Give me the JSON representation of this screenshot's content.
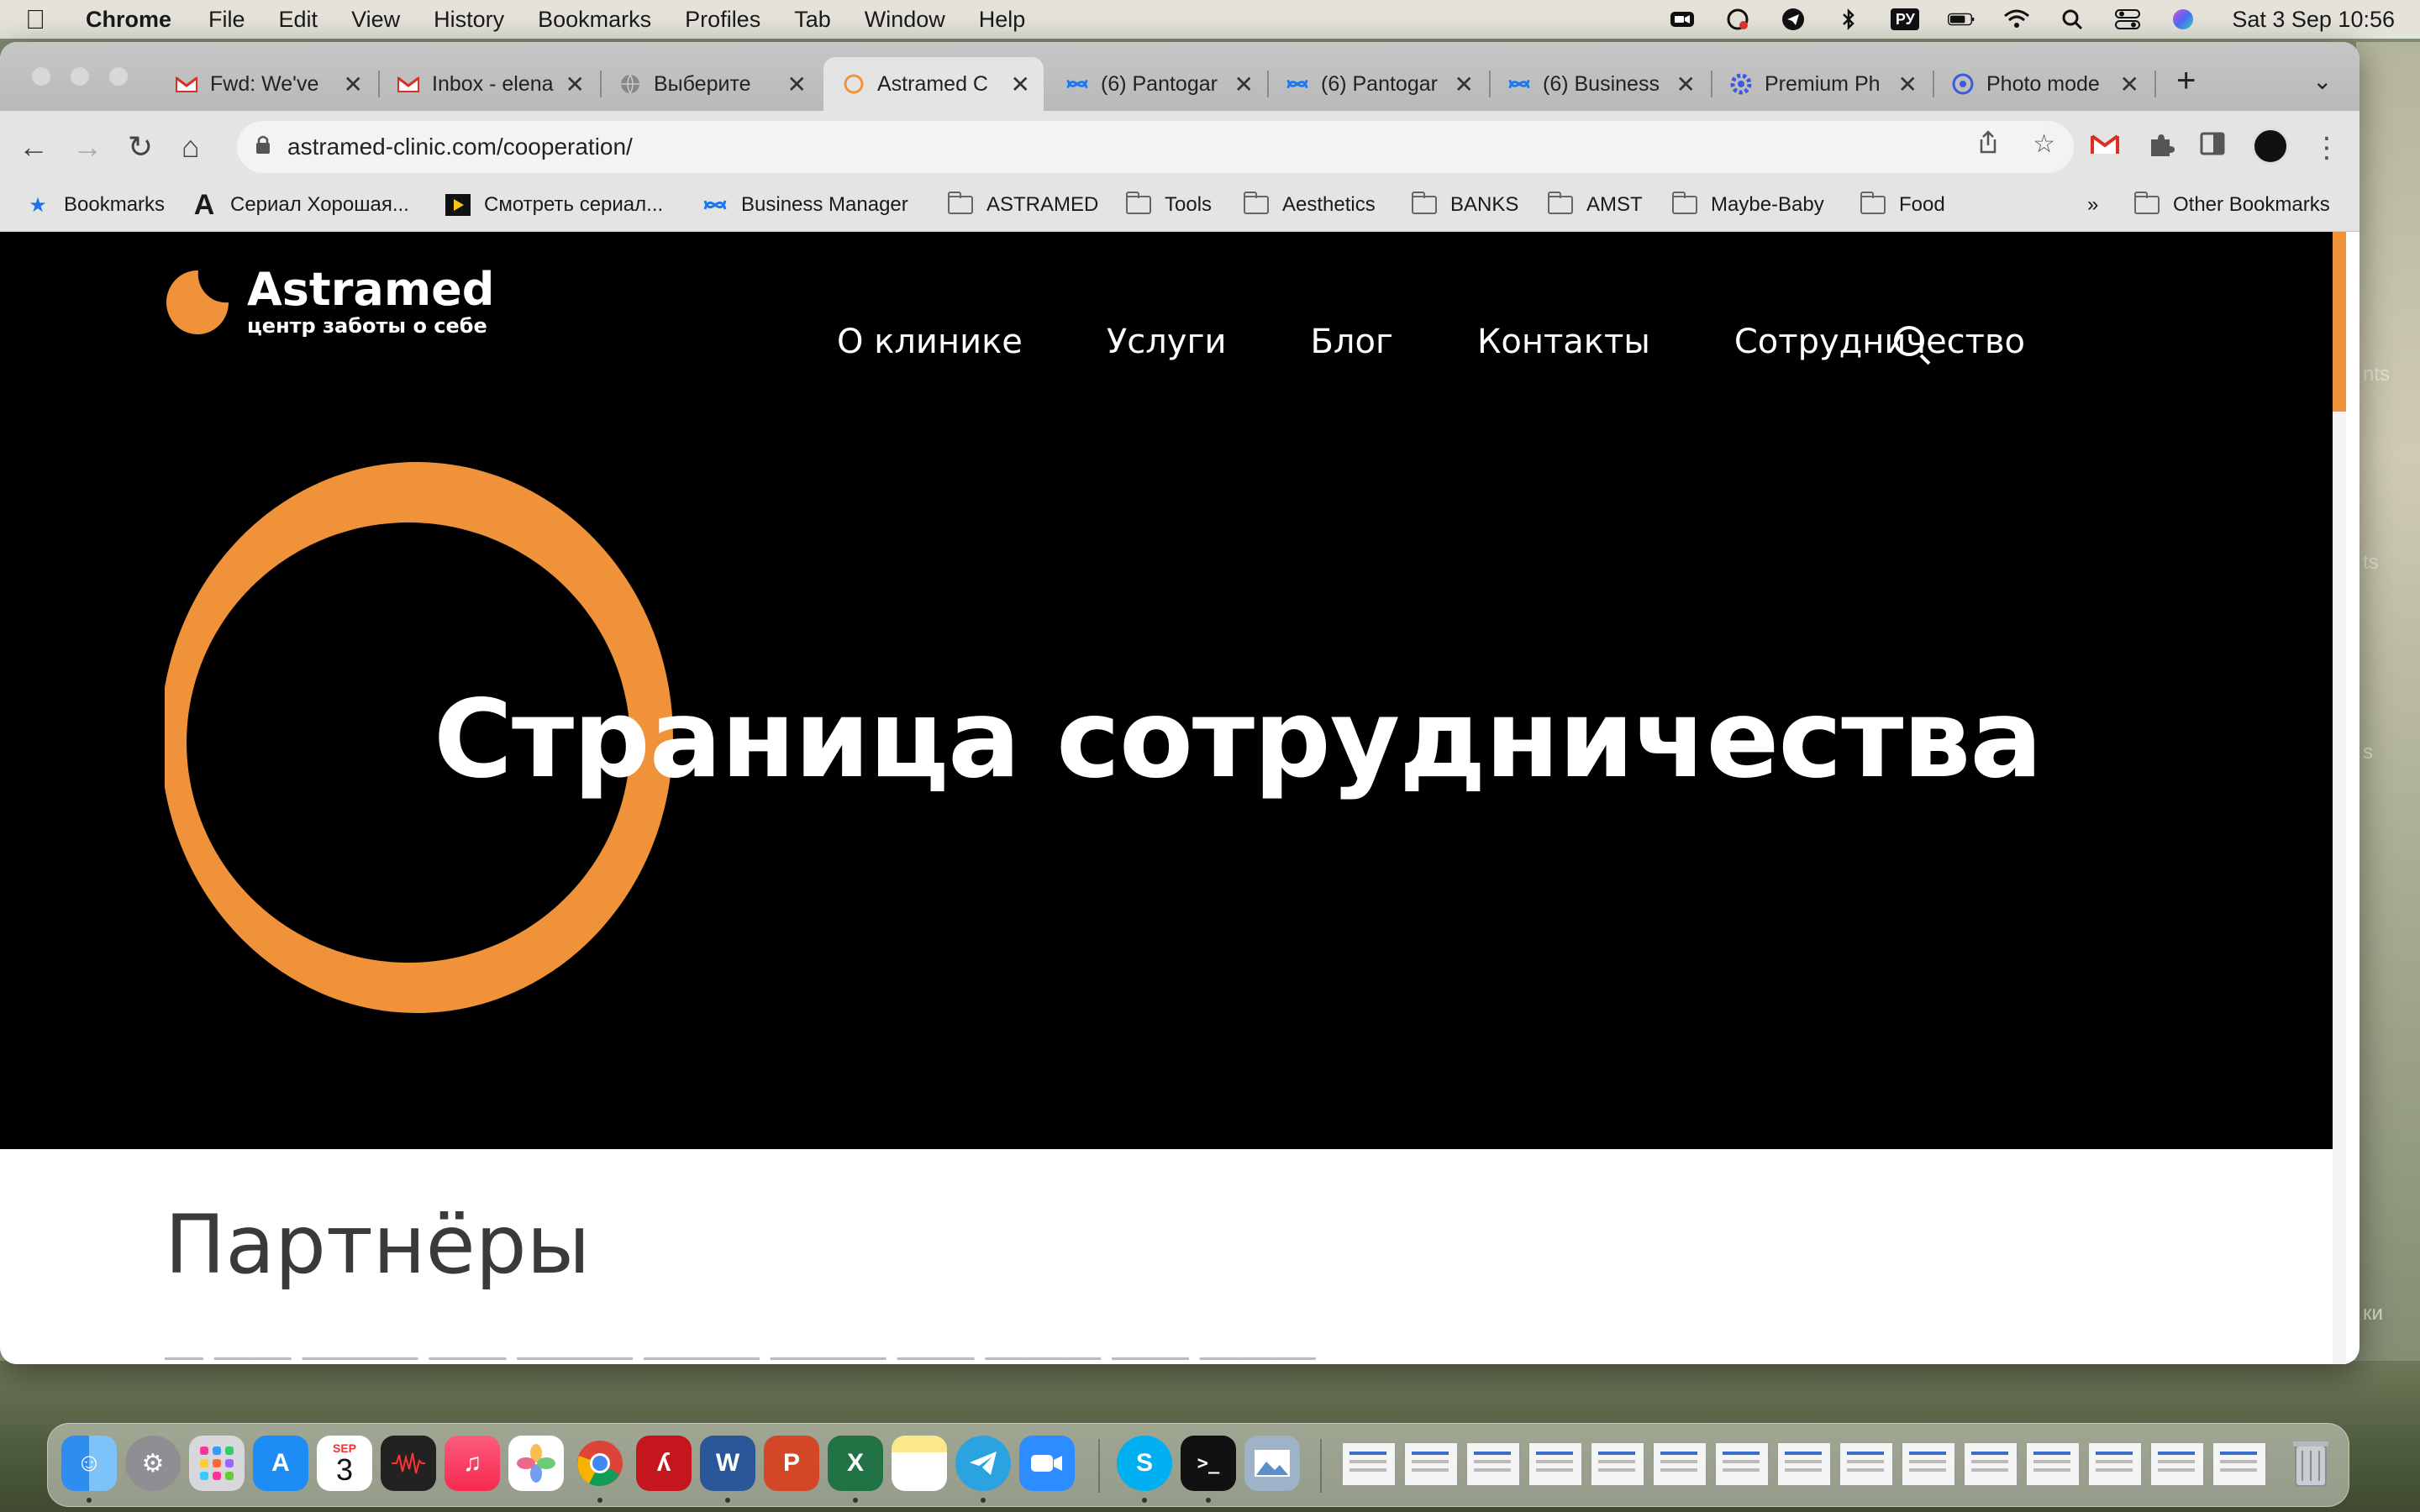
{
  "menubar": {
    "app_name": "Chrome",
    "items": [
      "File",
      "Edit",
      "View",
      "History",
      "Bookmarks",
      "Profiles",
      "Tab",
      "Window",
      "Help"
    ],
    "keyboard_layout": "РУ",
    "clock": "Sat 3 Sep  10:56"
  },
  "tabs": [
    {
      "label": "Fwd: We've",
      "icon": "gmail-icon",
      "active": false
    },
    {
      "label": "Inbox - elena",
      "icon": "gmail-icon",
      "active": false
    },
    {
      "label": "Выберите",
      "icon": "globe-icon",
      "active": false
    },
    {
      "label": "Astramed C",
      "icon": "astramed-icon",
      "active": true
    },
    {
      "label": "(6) Pantogar",
      "icon": "meta-icon",
      "active": false
    },
    {
      "label": "(6) Pantogar",
      "icon": "meta-icon",
      "active": false
    },
    {
      "label": "(6) Business",
      "icon": "meta-icon",
      "active": false
    },
    {
      "label": "Premium Ph",
      "icon": "gear-icon",
      "active": false
    },
    {
      "label": "Photo mode",
      "icon": "photo-icon",
      "active": false
    }
  ],
  "address_bar": {
    "url": "astramed-clinic.com/cooperation/"
  },
  "bookmarks": {
    "items": [
      {
        "label": "Bookmarks",
        "icon": "star-icon"
      },
      {
        "label": "Сериал Хорошая...",
        "icon": "site-icon"
      },
      {
        "label": "Смотреть сериал...",
        "icon": "play-icon"
      },
      {
        "label": "Business Manager",
        "icon": "meta-icon"
      },
      {
        "label": "ASTRAMED",
        "icon": "folder-icon"
      },
      {
        "label": "Tools",
        "icon": "folder-icon"
      },
      {
        "label": "Aesthetics",
        "icon": "folder-icon"
      },
      {
        "label": "BANKS",
        "icon": "folder-icon"
      },
      {
        "label": "AMST",
        "icon": "folder-icon"
      },
      {
        "label": "Maybe-Baby",
        "icon": "folder-icon"
      },
      {
        "label": "Food",
        "icon": "folder-icon"
      }
    ],
    "overflow": "»",
    "other": "Other Bookmarks"
  },
  "site": {
    "logo_name": "Astramed",
    "logo_tagline": "центр заботы о себе",
    "nav": [
      "О клинике",
      "Услуги",
      "Блог",
      "Контакты",
      "Сотрудничество"
    ],
    "hero_title": "Страница сотрудничества",
    "section_title": "Партнёры",
    "accent_color": "#f0923a"
  },
  "desktop": {
    "right_edge_labels": [
      "nts",
      "ts",
      "s",
      "ки"
    ]
  },
  "dock": {
    "calendar_month": "SEP",
    "calendar_day": "3"
  }
}
